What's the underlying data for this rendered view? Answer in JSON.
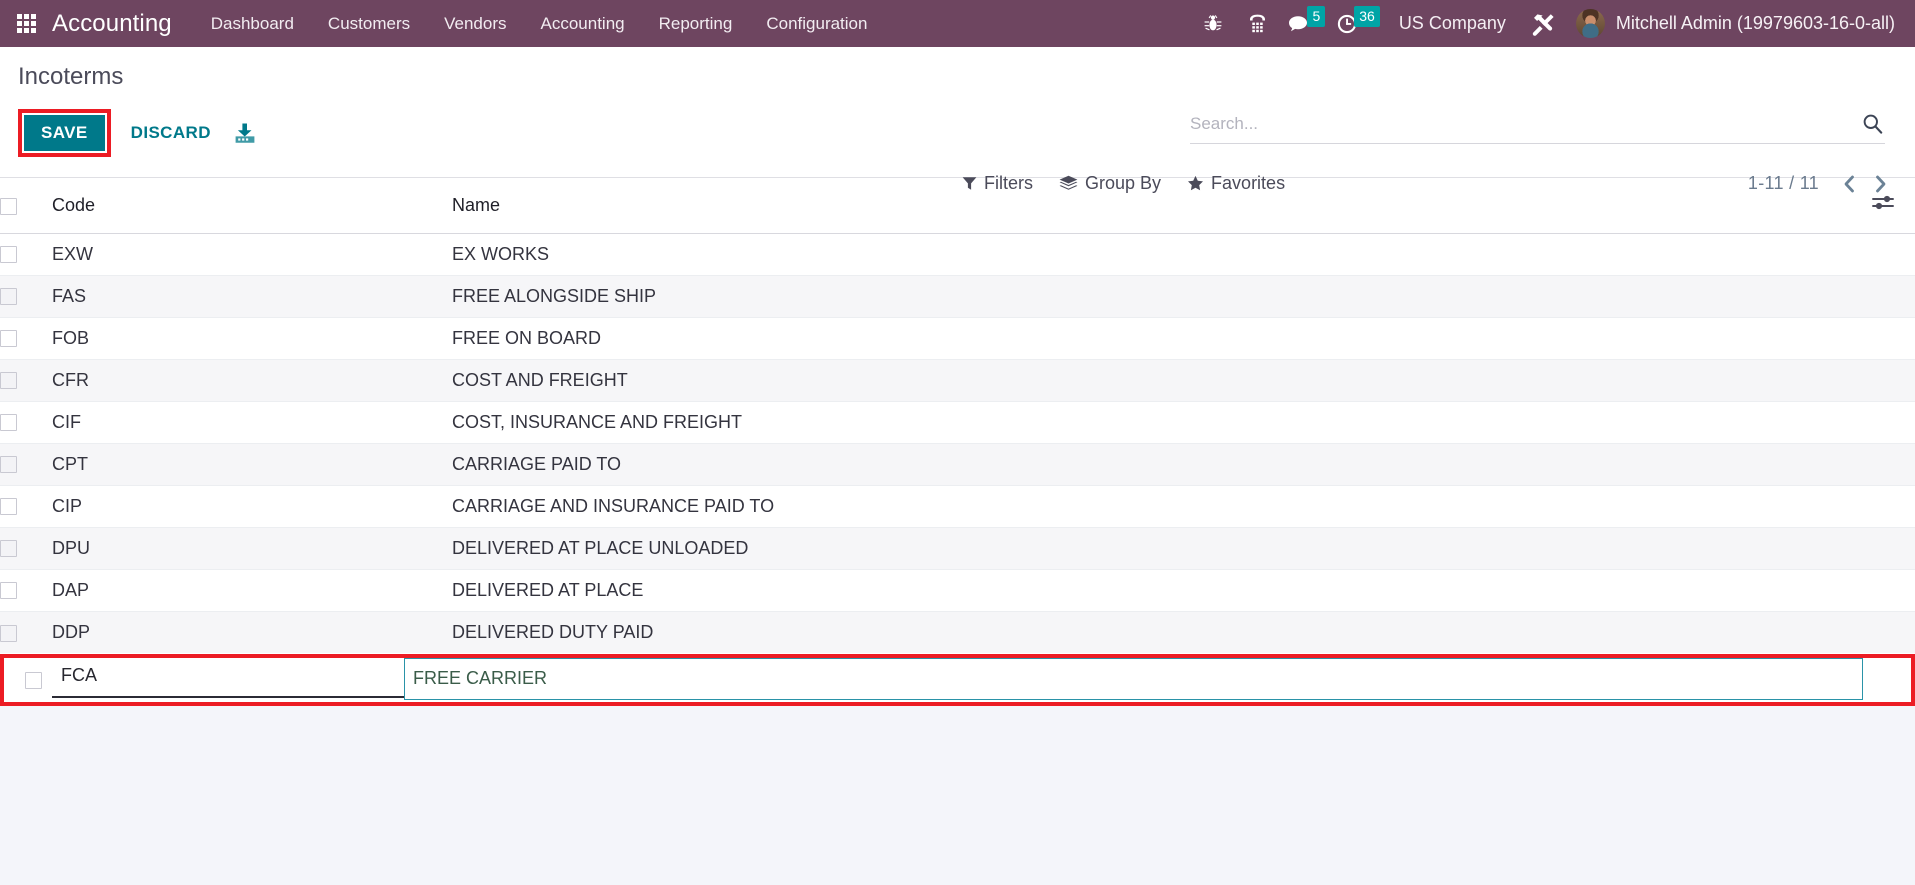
{
  "navbar": {
    "apps_icon": "apps-grid-icon",
    "brand": "Accounting",
    "menu": [
      {
        "label": "Dashboard"
      },
      {
        "label": "Customers"
      },
      {
        "label": "Vendors"
      },
      {
        "label": "Accounting"
      },
      {
        "label": "Reporting"
      },
      {
        "label": "Configuration"
      }
    ],
    "systray": {
      "debug_icon": "bug-icon",
      "voip_icon": "phone-dialpad-icon",
      "messages_icon": "chat-bubble-icon",
      "messages_count": "5",
      "activities_icon": "clock-icon",
      "activities_count": "36",
      "company": "US Company",
      "tools_icon": "wrench-screwdriver-icon",
      "avatar_icon": "user-avatar",
      "user_name": "Mitchell Admin (19979603-16-0-all)"
    },
    "accent_bg": "#6e4560",
    "badge_color": "#00a4a6"
  },
  "control_panel": {
    "breadcrumb": "Incoterms",
    "save_label": "SAVE",
    "discard_label": "DISCARD",
    "import_icon": "import-download-icon",
    "highlight_color": "#ec1c24",
    "save_color": "#00798a"
  },
  "search": {
    "placeholder": "Search...",
    "value": "",
    "search_icon": "search-magnifier-icon"
  },
  "filter_bar": {
    "filters": {
      "label": "Filters",
      "icon": "funnel-filter-icon"
    },
    "group_by": {
      "label": "Group By",
      "icon": "layers-stack-icon"
    },
    "favorites": {
      "label": "Favorites",
      "icon": "star-icon"
    }
  },
  "pager": {
    "value": "1-11 / 11",
    "prev_icon": "chevron-left-icon",
    "next_icon": "chevron-right-icon"
  },
  "list": {
    "columns": {
      "code": "Code",
      "name": "Name"
    },
    "options_icon": "column-options-sliders-icon",
    "rows": [
      {
        "code": "EXW",
        "name": "EX WORKS"
      },
      {
        "code": "FAS",
        "name": "FREE ALONGSIDE SHIP"
      },
      {
        "code": "FOB",
        "name": "FREE ON BOARD"
      },
      {
        "code": "CFR",
        "name": "COST AND FREIGHT"
      },
      {
        "code": "CIF",
        "name": "COST, INSURANCE AND FREIGHT"
      },
      {
        "code": "CPT",
        "name": "CARRIAGE PAID TO"
      },
      {
        "code": "CIP",
        "name": "CARRIAGE AND INSURANCE PAID TO"
      },
      {
        "code": "DPU",
        "name": "DELIVERED AT PLACE UNLOADED"
      },
      {
        "code": "DAP",
        "name": "DELIVERED AT PLACE"
      },
      {
        "code": "DDP",
        "name": "DELIVERED DUTY PAID"
      }
    ],
    "editing_row": {
      "code": "FCA",
      "name": "FREE CARRIER"
    }
  }
}
